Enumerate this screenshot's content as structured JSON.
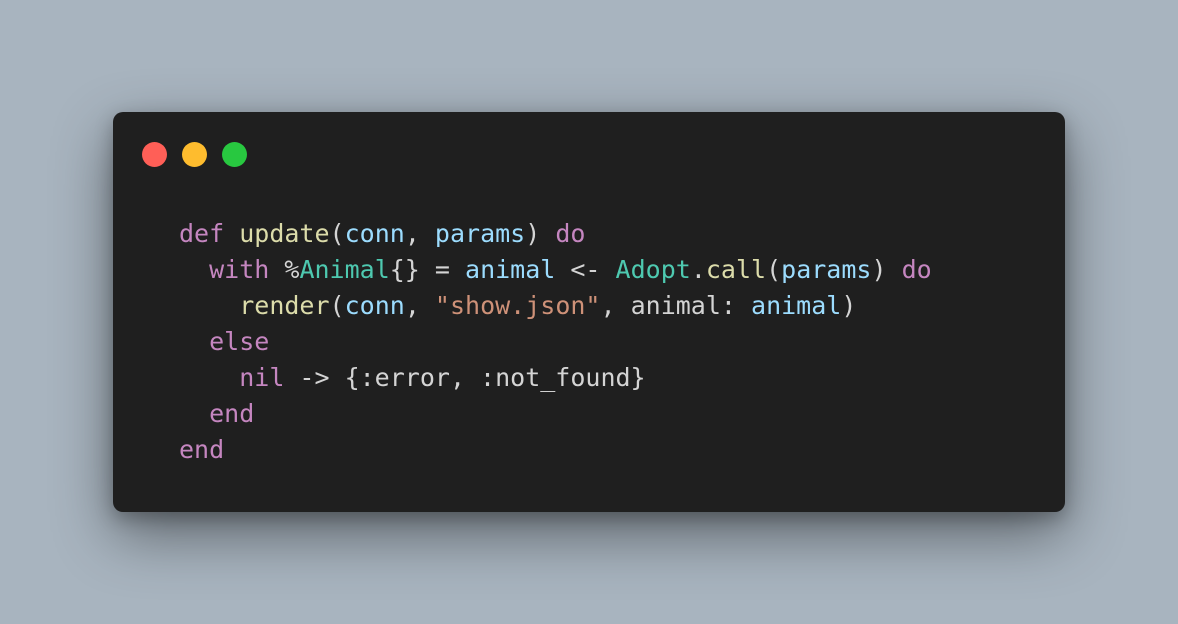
{
  "colors": {
    "background": "#a8b4bf",
    "window": "#1f1f1f",
    "close": "#ff5f57",
    "minimize": "#febc2e",
    "zoom": "#28c840",
    "keyword": "#c586c0",
    "function": "#dcdcaa",
    "variable": "#9cdcfe",
    "module": "#4ec9b0",
    "string": "#ce9178",
    "plain": "#d4d4d4"
  },
  "code": {
    "lines": [
      [
        {
          "t": "def",
          "c": "kw"
        },
        {
          "t": " ",
          "c": "pl"
        },
        {
          "t": "update",
          "c": "fn"
        },
        {
          "t": "(",
          "c": "pl"
        },
        {
          "t": "conn",
          "c": "var"
        },
        {
          "t": ", ",
          "c": "pl"
        },
        {
          "t": "params",
          "c": "var"
        },
        {
          "t": ") ",
          "c": "pl"
        },
        {
          "t": "do",
          "c": "kw"
        }
      ],
      [
        {
          "t": "  ",
          "c": "pl"
        },
        {
          "t": "with",
          "c": "kw"
        },
        {
          "t": " %",
          "c": "pl"
        },
        {
          "t": "Animal",
          "c": "mod"
        },
        {
          "t": "{} = ",
          "c": "pl"
        },
        {
          "t": "animal",
          "c": "var"
        },
        {
          "t": " <- ",
          "c": "pl"
        },
        {
          "t": "Adopt",
          "c": "mod"
        },
        {
          "t": ".",
          "c": "pl"
        },
        {
          "t": "call",
          "c": "fn"
        },
        {
          "t": "(",
          "c": "pl"
        },
        {
          "t": "params",
          "c": "var"
        },
        {
          "t": ") ",
          "c": "pl"
        },
        {
          "t": "do",
          "c": "kw"
        }
      ],
      [
        {
          "t": "    ",
          "c": "pl"
        },
        {
          "t": "render",
          "c": "fn"
        },
        {
          "t": "(",
          "c": "pl"
        },
        {
          "t": "conn",
          "c": "var"
        },
        {
          "t": ", ",
          "c": "pl"
        },
        {
          "t": "\"show.json\"",
          "c": "str"
        },
        {
          "t": ", animal: ",
          "c": "pl"
        },
        {
          "t": "animal",
          "c": "var"
        },
        {
          "t": ")",
          "c": "pl"
        }
      ],
      [
        {
          "t": "  ",
          "c": "pl"
        },
        {
          "t": "else",
          "c": "kw"
        }
      ],
      [
        {
          "t": "    ",
          "c": "pl"
        },
        {
          "t": "nil",
          "c": "kw"
        },
        {
          "t": " -> {:error, :not_found}",
          "c": "pl"
        }
      ],
      [
        {
          "t": "  ",
          "c": "pl"
        },
        {
          "t": "end",
          "c": "kw"
        }
      ],
      [
        {
          "t": "end",
          "c": "kw"
        }
      ]
    ]
  }
}
